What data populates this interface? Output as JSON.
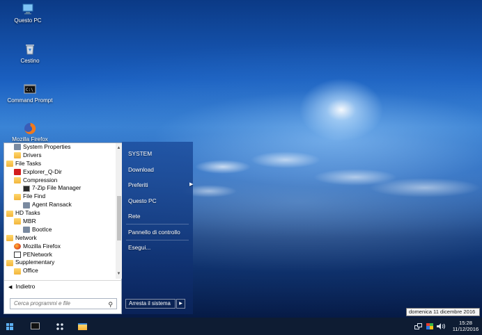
{
  "desktop": {
    "icons": [
      {
        "label": "Questo PC",
        "icon": "computer-icon"
      },
      {
        "label": "Cestino",
        "icon": "recycle-bin-icon"
      },
      {
        "label": "Command Prompt",
        "icon": "command-prompt-icon"
      },
      {
        "label": "Mozilla Firefox",
        "icon": "firefox-icon"
      }
    ]
  },
  "start_menu": {
    "programs": [
      {
        "label": "System Properties",
        "indent": 1,
        "icon": "system-properties-icon"
      },
      {
        "label": "Drivers",
        "indent": 1,
        "icon": "folder-icon"
      },
      {
        "label": "File Tasks",
        "indent": 0,
        "icon": "folder-icon"
      },
      {
        "label": "Explorer_Q-Dir",
        "indent": 1,
        "icon": "q-dir-icon"
      },
      {
        "label": "Compression",
        "indent": 1,
        "icon": "folder-icon"
      },
      {
        "label": "7-Zip File Manager",
        "indent": 2,
        "icon": "7zip-icon"
      },
      {
        "label": "File Find",
        "indent": 1,
        "icon": "folder-icon"
      },
      {
        "label": "Agent Ransack",
        "indent": 2,
        "icon": "agent-ransack-icon"
      },
      {
        "label": "HD Tasks",
        "indent": 0,
        "icon": "folder-icon"
      },
      {
        "label": "MBR",
        "indent": 1,
        "icon": "folder-icon"
      },
      {
        "label": "BootIce",
        "indent": 2,
        "icon": "bootice-icon"
      },
      {
        "label": "Network",
        "indent": 0,
        "icon": "folder-icon"
      },
      {
        "label": "Mozilla Firefox",
        "indent": 1,
        "icon": "firefox-icon"
      },
      {
        "label": "PENetwork",
        "indent": 1,
        "icon": "penetwork-icon"
      },
      {
        "label": "Supplementary",
        "indent": 0,
        "icon": "folder-icon"
      },
      {
        "label": "Office",
        "indent": 1,
        "icon": "folder-icon"
      }
    ],
    "back_label": "Indietro",
    "search_placeholder": "Cerca programmi e file",
    "right_items": [
      {
        "label": "SYSTEM",
        "has_submenu": false
      },
      {
        "label": "Download",
        "has_submenu": false
      },
      {
        "label": "Preferiti",
        "has_submenu": true
      },
      {
        "label": "Questo PC",
        "has_submenu": false
      },
      {
        "label": "Rete",
        "has_submenu": false
      },
      {
        "label": "Pannello di controllo",
        "has_submenu": false
      },
      {
        "label": "Esegui...",
        "has_submenu": false
      }
    ],
    "shutdown_label": "Arresta il sistema"
  },
  "tooltip": {
    "text": "domenica 11 dicembre 2016"
  },
  "taskbar": {
    "buttons": [
      "start-button",
      "command-prompt-task",
      "tiles-task",
      "file-explorer-task"
    ],
    "clock_time": "15:28",
    "clock_date": "11/12/2016"
  },
  "colors": {
    "taskbar": "#0e1c33",
    "start_right_panel": "#1e50a0",
    "accent": "#5eb0f2"
  }
}
